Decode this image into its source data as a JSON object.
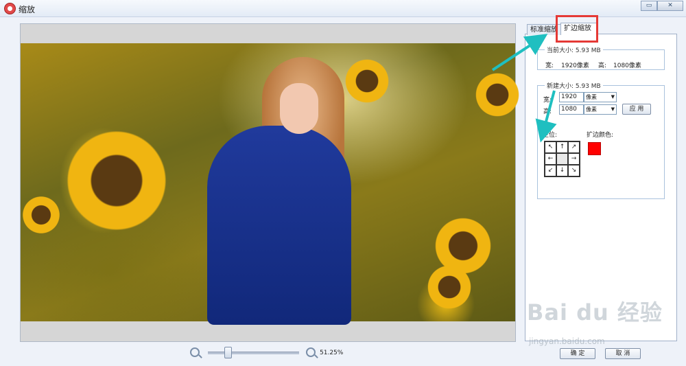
{
  "window": {
    "title": "缩放",
    "restore_label": "▭",
    "close_label": "✕"
  },
  "preview": {
    "zoom_value": "51.25%",
    "zoom_level": 0.22
  },
  "tabs": [
    {
      "label": "标准缩放",
      "active": false
    },
    {
      "label": "扩边缩放",
      "active": true
    }
  ],
  "current_size": {
    "title": "当前大小: 5.93 MB",
    "width_label": "宽:",
    "width_value": "1920像素",
    "height_label": "高:",
    "height_value": "1080像素"
  },
  "new_size": {
    "title": "新建大小: 5.93 MB",
    "width_label": "宽:",
    "width_value": "1920",
    "width_unit": "像素",
    "height_label": "高:",
    "height_value": "1080",
    "height_unit": "像素",
    "apply_label": "应 用",
    "anchor_label": "定位:",
    "anchor_cells": [
      "↖",
      "↑",
      "↗",
      "←",
      "",
      "→",
      "↙",
      "↓",
      "↘"
    ],
    "fill_color_label": "扩边颜色:",
    "fill_color": "#ff0000"
  },
  "buttons": {
    "ok_label": "确 定",
    "cancel_label": "取 消"
  },
  "watermark": {
    "text": "Bai du 经验",
    "sub": "jingyan.baidu.com"
  },
  "colors": {
    "annotation_box": "#e53935",
    "annotation_arrow": "#1fbfc0"
  }
}
